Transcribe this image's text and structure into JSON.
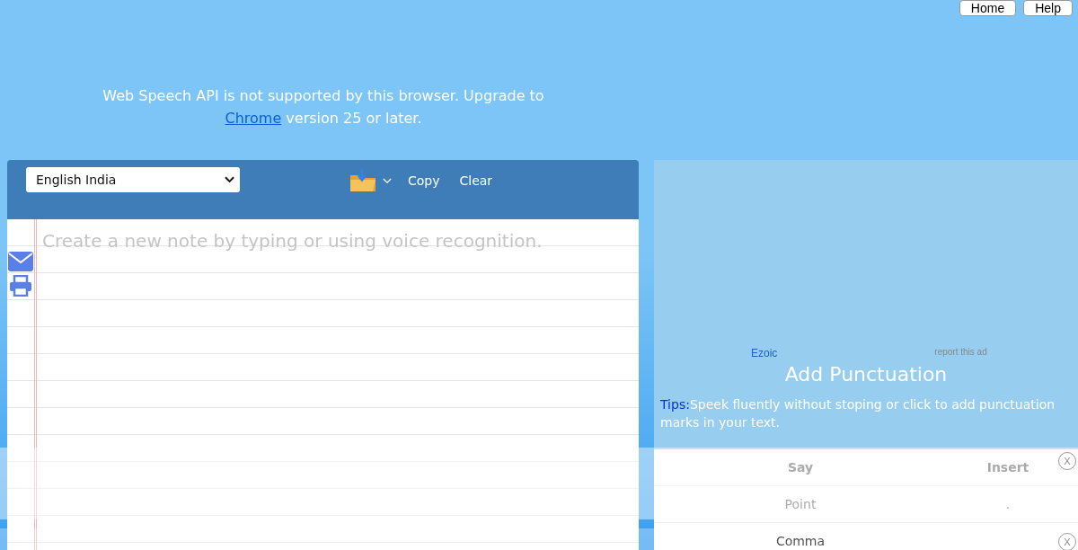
{
  "nav": [
    "Home",
    "Help"
  ],
  "notice": {
    "text": "Web Speech API is not supported by this browser. Upgrade to",
    "link": "Chrome",
    "after": "version 25 or later."
  },
  "editor": {
    "language": "English India",
    "actions": [
      "Copy",
      "Clear"
    ],
    "placeholder": "Create a new note by typing or using voice recognition."
  },
  "ad": {
    "brand": "Ezoic",
    "report": "report this ad"
  },
  "punctuation": {
    "title": "Add Punctuation",
    "tips_label": "Tips:",
    "tips": "Speek fluently without stoping or click to add punctuation marks in your text.",
    "columns": [
      "Say",
      "Insert"
    ],
    "rows": [
      {
        "say": "Point",
        "insert": "."
      },
      {
        "say": "Comma"
      }
    ]
  },
  "overlays": [
    {
      "close": "X"
    },
    {
      "close": "X"
    }
  ]
}
